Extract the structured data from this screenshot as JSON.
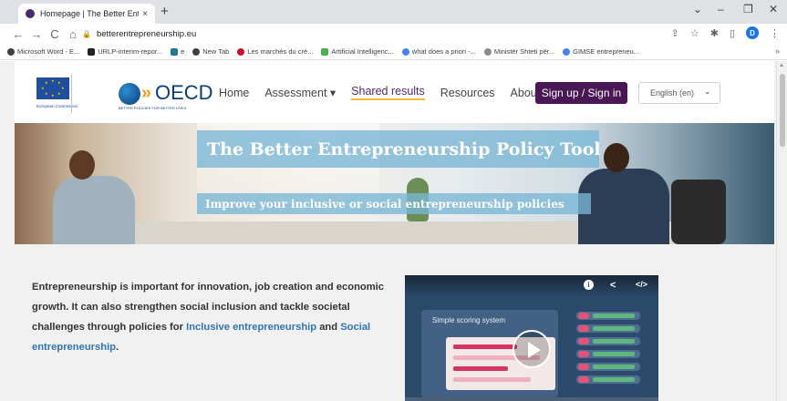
{
  "browser": {
    "tab": {
      "title": "Homepage | The Better Entrepre",
      "close": "×"
    },
    "new_tab": "+",
    "window_controls": {
      "chevron": "⌄",
      "minimize": "–",
      "restore": "❐",
      "close": "✕"
    },
    "nav": {
      "back": "←",
      "forward": "→",
      "reload": "C",
      "home": "⌂"
    },
    "url": "betterentrepreneurship.eu",
    "profile_initial": "D",
    "bookmarks": [
      {
        "label": "Microsoft Word - E...",
        "color": "#3c4043"
      },
      {
        "label": "URLP-interim-repor...",
        "color": "#202124"
      },
      {
        "label": "e",
        "color": "#1f7a8c"
      },
      {
        "label": "New Tab",
        "color": "#3c4043"
      },
      {
        "label": "Les marchés du cré...",
        "color": "#c8102e"
      },
      {
        "label": "Artificial Intelligenc...",
        "color": "#4caf50"
      },
      {
        "label": "what does a priori -...",
        "color": "#4285f4"
      },
      {
        "label": "Ministër Shteti për...",
        "color": "#8a8a8a"
      },
      {
        "label": "GIMSE entrepreneu...",
        "color": "#4285f4"
      }
    ],
    "bookmarks_more": "»"
  },
  "header": {
    "eu_text": "European Commission",
    "oecd_word": "OECD",
    "oecd_tagline": "BETTER POLICIES FOR BETTER LIVES",
    "nav": {
      "home": "Home",
      "assessment": "Assessment ▾",
      "shared_results": "Shared results",
      "resources": "Resources",
      "about": "About"
    },
    "signin": "Sign up / Sign in",
    "language": "English (en)"
  },
  "hero": {
    "title": "The Better Entrepreneurship Policy Tool",
    "subtitle": "Improve your inclusive or social entrepreneurship policies"
  },
  "intro": {
    "text1": "Entrepreneurship is important for innovation, job creation and economic growth. It can also strengthen social inclusion and tackle societal challenges through policies for ",
    "link1": "Inclusive entrepreneurship",
    "text2": " and ",
    "link2": "Social entrepreneurship",
    "text3": "."
  },
  "video": {
    "scoring_label": "Simple scoring system",
    "info_icon": "i",
    "share_icon": "<",
    "embed_icon": "</>"
  },
  "colors": {
    "brand_purple": "#4a1754",
    "link_blue": "#2f74b5",
    "hero_overlay": "#78b6d5",
    "nav_underline": "#f3b733"
  }
}
